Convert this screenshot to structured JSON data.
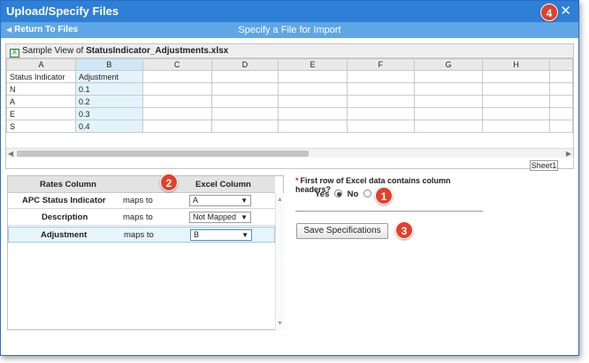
{
  "dialog": {
    "title": "Upload/Specify Files",
    "close_glyph": "✕"
  },
  "subbar": {
    "back_label": "Return To Files",
    "back_glyph": "◀",
    "center_title": "Specify a File for Import"
  },
  "badges": [
    "1",
    "2",
    "3",
    "4"
  ],
  "sample": {
    "caption_prefix": "Sample View of",
    "file_name": "StatusIndicator_Adjustments.xlsx",
    "xls_glyph": "X",
    "columns": [
      "A",
      "B",
      "C",
      "D",
      "E",
      "F",
      "G",
      "H"
    ],
    "rows": [
      [
        "Status Indicator",
        "Adjustment"
      ],
      [
        "N",
        "0.1"
      ],
      [
        "A",
        "0.2"
      ],
      [
        "E",
        "0.3"
      ],
      [
        "S",
        "0.4"
      ]
    ],
    "sheet_name": "Sheet1",
    "scroll_left_glyph": "◀",
    "scroll_right_glyph": "▶"
  },
  "mapping": {
    "header_rates": "Rates Column",
    "header_excel": "Excel Column",
    "caret": "▼",
    "rows": [
      {
        "rates_column": "APC Status Indicator",
        "maps_to": "maps to",
        "excel_column": "A"
      },
      {
        "rates_column": "Description",
        "maps_to": "maps to",
        "excel_column": "Not Mapped"
      },
      {
        "rates_column": "Adjustment",
        "maps_to": "maps to",
        "excel_column": "B"
      }
    ],
    "scroll_up_glyph": "▲",
    "scroll_down_glyph": "▼"
  },
  "options": {
    "required_mark": "*",
    "question": "First row of Excel data contains column headers?",
    "yes_label": "Yes",
    "no_label": "No",
    "selected": "Yes"
  },
  "save_label": "Save Specifications",
  "colors": {
    "titlebar": "#2e7fd6",
    "subbar": "#5fa6e6",
    "badge": "#e2402a",
    "selected_column": "#cfe8f7"
  }
}
